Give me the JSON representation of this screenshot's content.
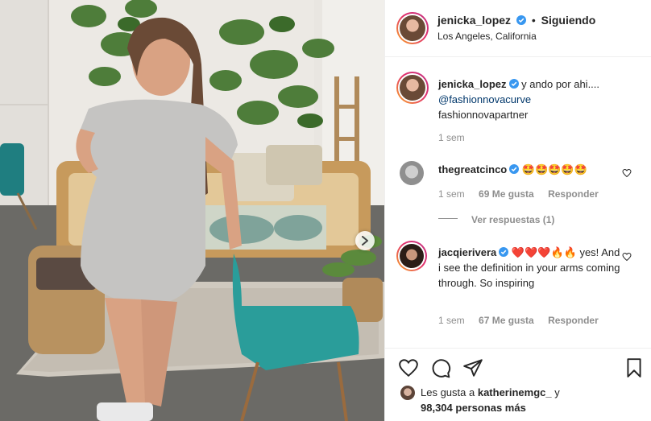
{
  "header": {
    "username": "jenicka_lopez",
    "separator": "•",
    "follow_status": "Siguiendo",
    "location": "Los Angeles, California"
  },
  "caption": {
    "username": "jenicka_lopez",
    "text": "y ando por ahi....",
    "mention": "@fashionnovacurve",
    "hashtag_line": "fashionnovapartner",
    "time": "1 sem"
  },
  "comments": [
    {
      "username": "thegreatcinco",
      "verified": true,
      "text": "🤩🤩🤩🤩🤩",
      "time": "1 sem",
      "likes": "69 Me gusta",
      "reply": "Responder",
      "view_replies": "Ver respuestas (1)"
    },
    {
      "username": "jacqierivera",
      "verified": true,
      "text_emoji": "❤️❤️❤️🔥🔥",
      "text_tail": " yes!",
      "text_body": "And i see the definition in your arms coming through. So inspiring",
      "time": "1 sem",
      "likes": "67 Me gusta",
      "reply": "Responder"
    }
  ],
  "likes_line": {
    "prefix": "Les gusta a",
    "user": "katherinemgc_",
    "and": "y",
    "count": "98,304 personas más"
  },
  "icons": {
    "like": "heart-outline-icon",
    "comment": "comment-bubble-icon",
    "share": "paper-plane-icon",
    "save": "bookmark-icon",
    "next": "chevron-right-icon",
    "verified": "verified-badge-icon"
  },
  "colors": {
    "verified_blue": "#3897f0",
    "link": "#00376b",
    "muted": "#8e8e8e",
    "chair_teal": "#2a9d9a"
  }
}
